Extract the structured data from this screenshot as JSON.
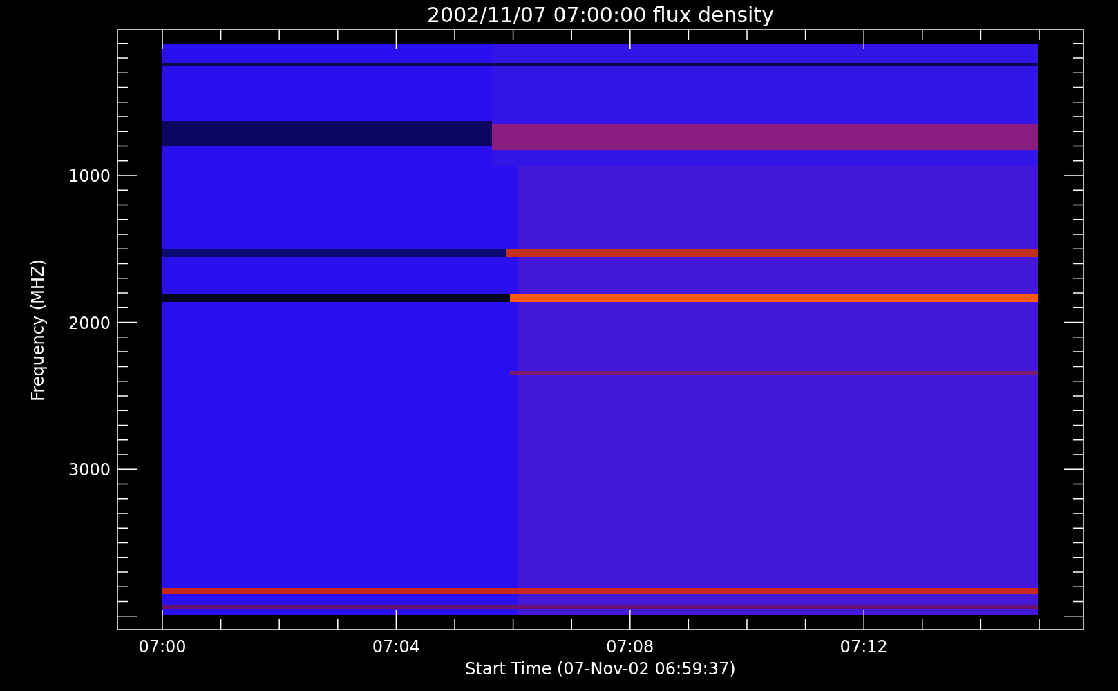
{
  "title": "2002/11/07 07:00:00 flux density",
  "y_axis": {
    "label": "Frequency (MHZ)",
    "ticks": [
      "1000",
      "2000",
      "3000"
    ]
  },
  "x_axis": {
    "label": "Start Time (07-Nov-02 06:59:37)",
    "ticks": [
      "07:00",
      "07:04",
      "07:08",
      "07:12"
    ]
  }
}
